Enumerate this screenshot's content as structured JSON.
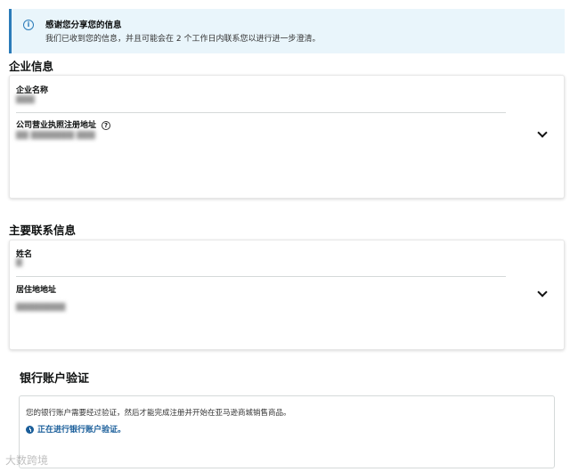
{
  "alert": {
    "title": "感谢您分享您的信息",
    "body": "我们已收到您的信息，并且可能会在 2 个工作日内联系您以进行进一步澄清。"
  },
  "business_info": {
    "heading": "企业信息",
    "name_label": "企业名称",
    "name_value": "▇▇▇",
    "address_label": "公司营业执照注册地址",
    "address_value": "▇▇ ▇▇▇▇▇▇▇ ▇▇▇"
  },
  "contact_info": {
    "heading": "主要联系信息",
    "name_label": "姓名",
    "name_value": "▇",
    "address_label": "居住地地址",
    "address_value": "▇▇▇▇▇▇▇▇"
  },
  "bank": {
    "heading": "银行账户验证",
    "description": "您的银行账户需要经过验证，然后才能完成注册并开始在亚马逊商城销售商品。",
    "status": "正在进行银行账户验证。"
  },
  "watermark": "大数跨境"
}
